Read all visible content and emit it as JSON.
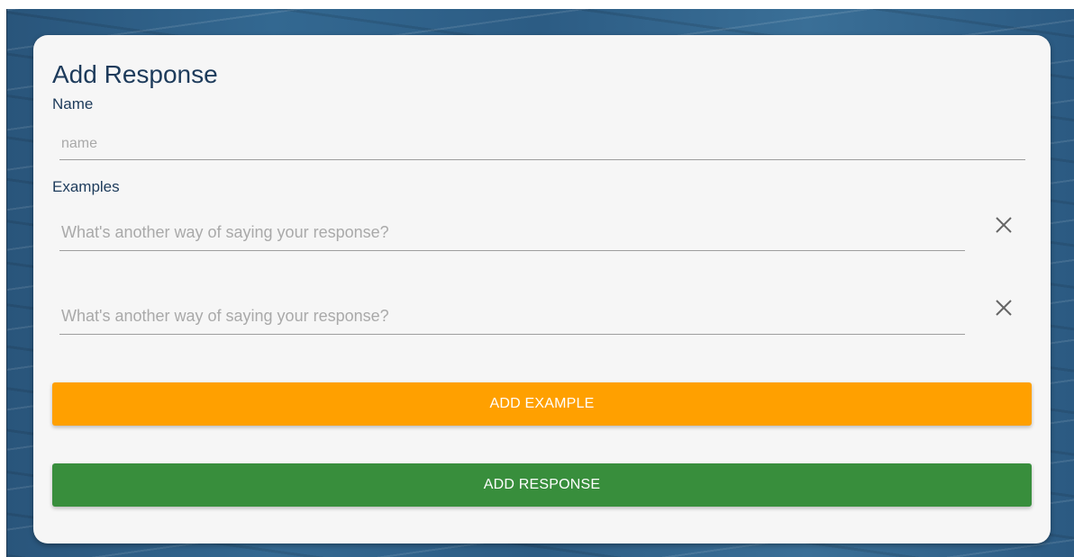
{
  "form": {
    "title": "Add Response",
    "name_label": "Name",
    "name_placeholder": "name",
    "name_value": "",
    "examples_label": "Examples",
    "examples": [
      {
        "placeholder": "What's another way of saying your response?",
        "value": ""
      },
      {
        "placeholder": "What's another way of saying your response?",
        "value": ""
      }
    ],
    "remove_icon": "close-icon",
    "add_example_label": "ADD EXAMPLE",
    "add_response_label": "ADD RESPONSE"
  },
  "colors": {
    "title_text": "#1d3b5b",
    "card_background": "#f6f6f6",
    "add_example_button": "#ffa000",
    "add_response_button": "#388e3c",
    "backdrop": "#2d5f88"
  }
}
